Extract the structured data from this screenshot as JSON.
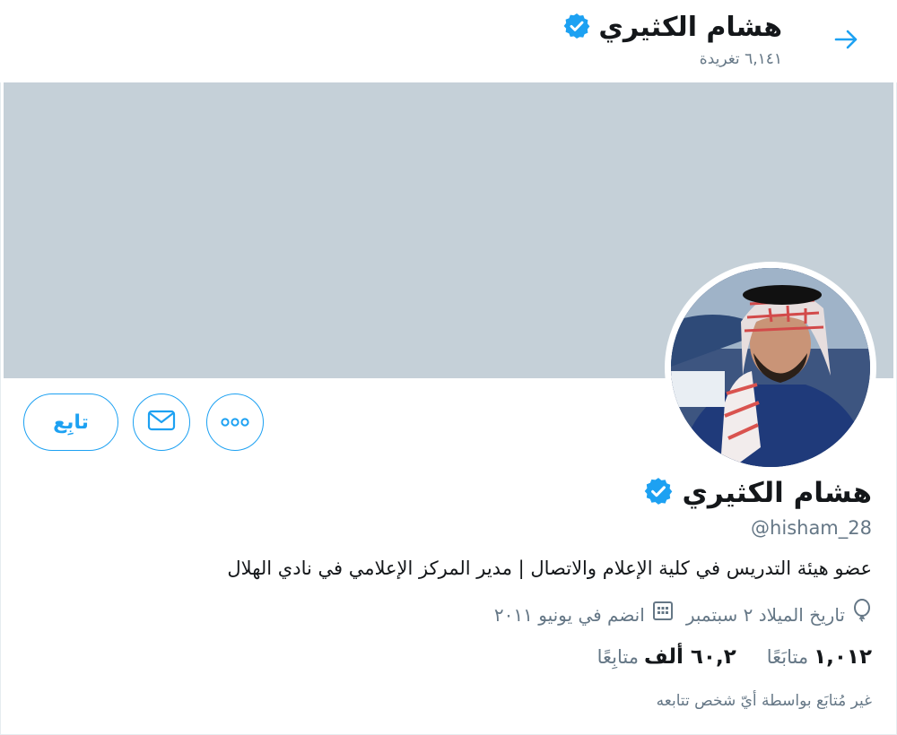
{
  "header": {
    "name": "هشام الكثيري",
    "tweet_count": "٦,١٤١ تغريدة",
    "back_icon": "arrow-right-icon"
  },
  "profile": {
    "name": "هشام الكثيري",
    "verified_icon": "verified-badge-icon",
    "handle": "@hisham_28",
    "bio": "عضو هيئة التدريس في كلية الإعلام والاتصال | مدير المركز الإعلامي في نادي الهلال",
    "birthday": "تاريخ الميلاد ٢ سبتمبر",
    "joined": "انضم في يونيو ٢٠١١",
    "following_count": "١,٠١٢",
    "following_label": "متابَعًا",
    "followers_count": "٦٠,٢ ألف",
    "followers_label": "متابِعًا",
    "not_followed": "غير مُتابَع بواسطة أيّ شخص تتابعه"
  },
  "actions": {
    "follow_label": "تابِع",
    "message_icon": "envelope-icon",
    "more_icon": "more-dots-icon"
  },
  "colors": {
    "accent": "#1da1f2",
    "banner": "#c5d0d8",
    "secondary_text": "#657786"
  }
}
